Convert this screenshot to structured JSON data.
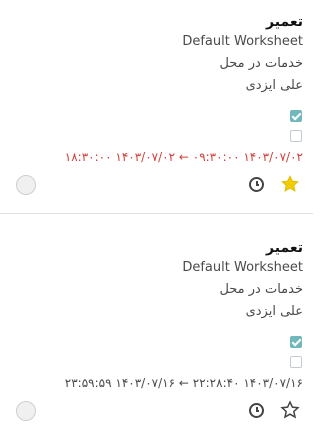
{
  "cards": [
    {
      "title": "تعمیر",
      "worksheet": "Default Worksheet",
      "service": "خدمات در محل",
      "person": "علی ایزدی",
      "checkbox_1_checked": true,
      "checkbox_2_checked": false,
      "start": "۱۴۰۳/۰۷/۰۲ ۰۹:۳۰:۰۰",
      "arrow": "←",
      "end": "۱۴۰۳/۰۷/۰۲ ۱۸:۳۰:۰۰",
      "dates_status": "overdue",
      "starred": true,
      "star_color": "#f3cc00",
      "overdue_color": "#d23f3a"
    },
    {
      "title": "تعمیر",
      "worksheet": "Default Worksheet",
      "service": "خدمات در محل",
      "person": "علی ایزدی",
      "checkbox_1_checked": true,
      "checkbox_2_checked": false,
      "start": "۱۴۰۳/۰۷/۱۶ ۲۲:۲۸:۴۰",
      "arrow": "←",
      "end": "۱۴۰۳/۰۷/۱۶ ۲۳:۵۹:۵۹",
      "dates_status": "normal",
      "starred": false,
      "star_color": "#444444"
    }
  ]
}
